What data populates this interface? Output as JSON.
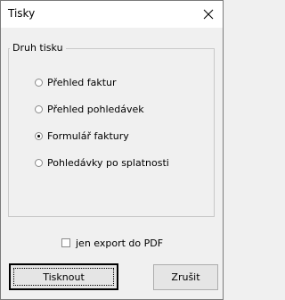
{
  "window": {
    "title": "Tisky",
    "close_symbol": "×"
  },
  "group": {
    "legend": "Druh tisku",
    "options": [
      {
        "label": "Přehled faktur",
        "checked": false
      },
      {
        "label": "Přehled pohledávek",
        "checked": false
      },
      {
        "label": "Formulář faktury",
        "checked": true
      },
      {
        "label": "Pohledávky po splatnosti",
        "checked": false
      }
    ]
  },
  "export_checkbox": {
    "label": "jen export do PDF",
    "checked": false
  },
  "buttons": {
    "print_label": "Tisknout",
    "cancel_label": "Zrušit"
  },
  "icons": {
    "close": "close-icon"
  }
}
